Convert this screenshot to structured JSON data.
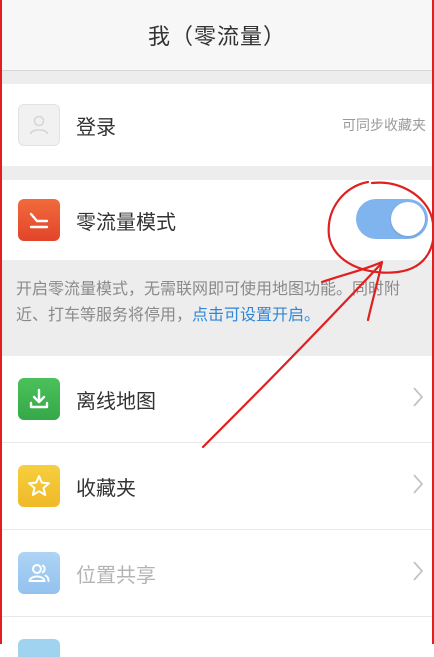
{
  "header": {
    "title": "我（零流量）"
  },
  "login_row": {
    "label": "登录",
    "hint": "可同步收藏夹"
  },
  "zero_flow_row": {
    "label": "零流量模式",
    "toggle_on": true
  },
  "info": {
    "text": "开启零流量模式，无需联网即可使用地图功能。同时附近、打车等服务将停用，",
    "link": "点击可设置开启。"
  },
  "list": {
    "items": [
      {
        "label": "离线地图",
        "icon": "download-icon"
      },
      {
        "label": "收藏夹",
        "icon": "star-icon"
      },
      {
        "label": "位置共享",
        "icon": "people-icon"
      }
    ]
  },
  "colors": {
    "accent_blue": "#2f86d8",
    "toggle_on": "#7fb4ee",
    "zero_icon": "#e9522f",
    "offline_icon": "#3fb552",
    "favorites_icon": "#f3c231",
    "share_icon": "#9fcaf0",
    "annotation_red": "#e02020"
  }
}
